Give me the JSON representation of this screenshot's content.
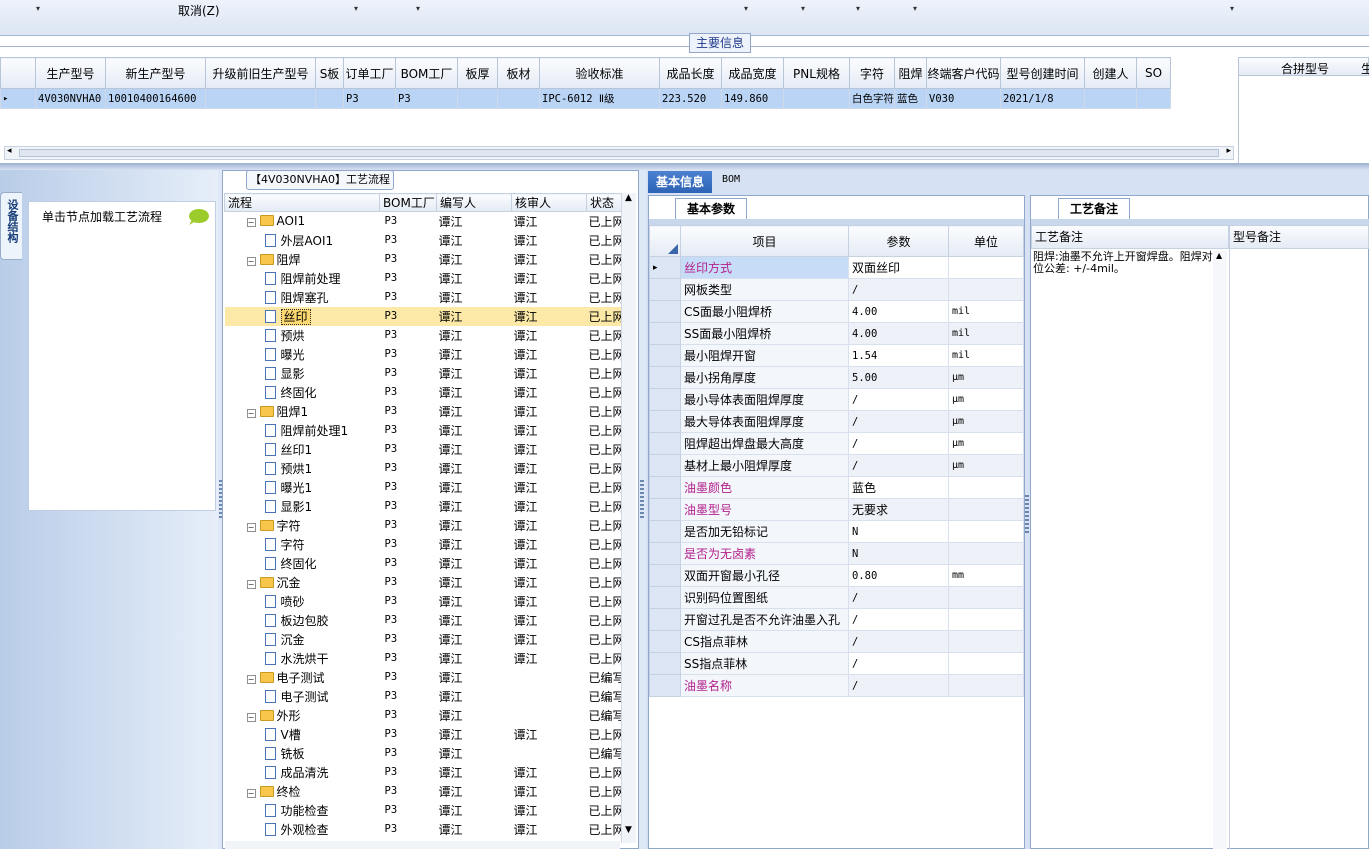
{
  "toolbar": {
    "cancel_label": "取消(Z)"
  },
  "main_info": {
    "tab_label": "主要信息",
    "columns": [
      "生产型号",
      "新生产型号",
      "升级前旧生产型号",
      "S板",
      "订单工厂",
      "BOM工厂",
      "板厚",
      "板材",
      "验收标准",
      "成品长度",
      "成品宽度",
      "PNL规格",
      "字符",
      "阻焊",
      "终端客户代码",
      "型号创建时间",
      "创建人",
      "SO"
    ],
    "row": [
      "4V030NVHA0",
      "10010400164600",
      "",
      "",
      "P3",
      "P3",
      "",
      "",
      "IPC-6012 Ⅱ级",
      "223.520",
      "149.860",
      "",
      "白色字符",
      "蓝色",
      "V030",
      "2021/1/8",
      "",
      ""
    ],
    "merge_column": "合拼型号",
    "extra_column": "生"
  },
  "left_nav": {
    "vertical_tab": "设备结构",
    "load_hint": "单击节点加载工艺流程"
  },
  "flow": {
    "title": "【4V030NVHA0】工艺流程",
    "columns": [
      "流程",
      "BOM工厂",
      "编写人",
      "核审人",
      "状态"
    ],
    "rows": [
      {
        "name": "AOI1",
        "level": 0,
        "folder": true,
        "bom": "P3",
        "writer": "谭江",
        "reviewer": "谭江",
        "status": "已上网"
      },
      {
        "name": "外层AOI1",
        "level": 1,
        "folder": false,
        "bom": "P3",
        "writer": "谭江",
        "reviewer": "谭江",
        "status": "已上网"
      },
      {
        "name": "阻焊",
        "level": 0,
        "folder": true,
        "bom": "P3",
        "writer": "谭江",
        "reviewer": "谭江",
        "status": "已上网"
      },
      {
        "name": "阻焊前处理",
        "level": 1,
        "folder": false,
        "bom": "P3",
        "writer": "谭江",
        "reviewer": "谭江",
        "status": "已上网"
      },
      {
        "name": "阻焊塞孔",
        "level": 1,
        "folder": false,
        "bom": "P3",
        "writer": "谭江",
        "reviewer": "谭江",
        "status": "已上网"
      },
      {
        "name": "丝印",
        "level": 1,
        "folder": false,
        "bom": "P3",
        "writer": "谭江",
        "reviewer": "谭江",
        "status": "已上网",
        "selected": true
      },
      {
        "name": "预烘",
        "level": 1,
        "folder": false,
        "bom": "P3",
        "writer": "谭江",
        "reviewer": "谭江",
        "status": "已上网"
      },
      {
        "name": "曝光",
        "level": 1,
        "folder": false,
        "bom": "P3",
        "writer": "谭江",
        "reviewer": "谭江",
        "status": "已上网"
      },
      {
        "name": "显影",
        "level": 1,
        "folder": false,
        "bom": "P3",
        "writer": "谭江",
        "reviewer": "谭江",
        "status": "已上网"
      },
      {
        "name": "终固化",
        "level": 1,
        "folder": false,
        "bom": "P3",
        "writer": "谭江",
        "reviewer": "谭江",
        "status": "已上网"
      },
      {
        "name": "阻焊1",
        "level": 0,
        "folder": true,
        "bom": "P3",
        "writer": "谭江",
        "reviewer": "谭江",
        "status": "已上网"
      },
      {
        "name": "阻焊前处理1",
        "level": 1,
        "folder": false,
        "bom": "P3",
        "writer": "谭江",
        "reviewer": "谭江",
        "status": "已上网"
      },
      {
        "name": "丝印1",
        "level": 1,
        "folder": false,
        "bom": "P3",
        "writer": "谭江",
        "reviewer": "谭江",
        "status": "已上网"
      },
      {
        "name": "预烘1",
        "level": 1,
        "folder": false,
        "bom": "P3",
        "writer": "谭江",
        "reviewer": "谭江",
        "status": "已上网"
      },
      {
        "name": "曝光1",
        "level": 1,
        "folder": false,
        "bom": "P3",
        "writer": "谭江",
        "reviewer": "谭江",
        "status": "已上网"
      },
      {
        "name": "显影1",
        "level": 1,
        "folder": false,
        "bom": "P3",
        "writer": "谭江",
        "reviewer": "谭江",
        "status": "已上网"
      },
      {
        "name": "字符",
        "level": 0,
        "folder": true,
        "bom": "P3",
        "writer": "谭江",
        "reviewer": "谭江",
        "status": "已上网"
      },
      {
        "name": "字符",
        "level": 1,
        "folder": false,
        "bom": "P3",
        "writer": "谭江",
        "reviewer": "谭江",
        "status": "已上网"
      },
      {
        "name": "终固化",
        "level": 1,
        "folder": false,
        "bom": "P3",
        "writer": "谭江",
        "reviewer": "谭江",
        "status": "已上网"
      },
      {
        "name": "沉金",
        "level": 0,
        "folder": true,
        "bom": "P3",
        "writer": "谭江",
        "reviewer": "谭江",
        "status": "已上网"
      },
      {
        "name": "喷砂",
        "level": 1,
        "folder": false,
        "bom": "P3",
        "writer": "谭江",
        "reviewer": "谭江",
        "status": "已上网"
      },
      {
        "name": "板边包胶",
        "level": 1,
        "folder": false,
        "bom": "P3",
        "writer": "谭江",
        "reviewer": "谭江",
        "status": "已上网"
      },
      {
        "name": "沉金",
        "level": 1,
        "folder": false,
        "bom": "P3",
        "writer": "谭江",
        "reviewer": "谭江",
        "status": "已上网"
      },
      {
        "name": "水洗烘干",
        "level": 1,
        "folder": false,
        "bom": "P3",
        "writer": "谭江",
        "reviewer": "谭江",
        "status": "已上网"
      },
      {
        "name": "电子测试",
        "level": 0,
        "folder": true,
        "bom": "P3",
        "writer": "谭江",
        "reviewer": "",
        "status": "已编写"
      },
      {
        "name": "电子测试",
        "level": 1,
        "folder": false,
        "bom": "P3",
        "writer": "谭江",
        "reviewer": "",
        "status": "已编写"
      },
      {
        "name": "外形",
        "level": 0,
        "folder": true,
        "bom": "P3",
        "writer": "谭江",
        "reviewer": "",
        "status": "已编写"
      },
      {
        "name": "V槽",
        "level": 1,
        "folder": false,
        "bom": "P3",
        "writer": "谭江",
        "reviewer": "谭江",
        "status": "已上网"
      },
      {
        "name": "铣板",
        "level": 1,
        "folder": false,
        "bom": "P3",
        "writer": "谭江",
        "reviewer": "",
        "status": "已编写"
      },
      {
        "name": "成品清洗",
        "level": 1,
        "folder": false,
        "bom": "P3",
        "writer": "谭江",
        "reviewer": "谭江",
        "status": "已上网"
      },
      {
        "name": "终检",
        "level": 0,
        "folder": true,
        "bom": "P3",
        "writer": "谭江",
        "reviewer": "谭江",
        "status": "已上网"
      },
      {
        "name": "功能检查",
        "level": 1,
        "folder": false,
        "bom": "P3",
        "writer": "谭江",
        "reviewer": "谭江",
        "status": "已上网"
      },
      {
        "name": "外观检查",
        "level": 1,
        "folder": false,
        "bom": "P3",
        "writer": "谭江",
        "reviewer": "谭江",
        "status": "已上网"
      }
    ]
  },
  "right_tabs": {
    "basic_info": "基本信息",
    "bom": "BOM"
  },
  "basic_params": {
    "tab_label": "基本参数",
    "columns": [
      "项目",
      "参数",
      "单位"
    ],
    "rows": [
      {
        "item": "丝印方式",
        "value": "双面丝印",
        "unit": "",
        "pink": true,
        "current": true
      },
      {
        "item": "网板类型",
        "value": "/",
        "unit": ""
      },
      {
        "item": "CS面最小阻焊桥",
        "value": "4.00",
        "unit": "mil"
      },
      {
        "item": "SS面最小阻焊桥",
        "value": "4.00",
        "unit": "mil"
      },
      {
        "item": "最小阻焊开窗",
        "value": "1.54",
        "unit": "mil"
      },
      {
        "item": "最小拐角厚度",
        "value": "5.00",
        "unit": "μm"
      },
      {
        "item": "最小导体表面阻焊厚度",
        "value": "/",
        "unit": "μm"
      },
      {
        "item": "最大导体表面阻焊厚度",
        "value": "/",
        "unit": "μm"
      },
      {
        "item": "阻焊超出焊盘最大高度",
        "value": "/",
        "unit": "μm"
      },
      {
        "item": "基材上最小阻焊厚度",
        "value": "/",
        "unit": "μm"
      },
      {
        "item": "油墨颜色",
        "value": "蓝色",
        "unit": "",
        "pink": true
      },
      {
        "item": "油墨型号",
        "value": "无要求",
        "unit": "",
        "pink": true
      },
      {
        "item": "是否加无铅标记",
        "value": "N",
        "unit": ""
      },
      {
        "item": "是否为无卤素",
        "value": "N",
        "unit": "",
        "pink": true
      },
      {
        "item": "双面开窗最小孔径",
        "value": "0.80",
        "unit": "mm"
      },
      {
        "item": "识别码位置图纸",
        "value": "/",
        "unit": ""
      },
      {
        "item": "开窗过孔是否不允许油墨入孔",
        "value": "/",
        "unit": ""
      },
      {
        "item": "CS指点菲林",
        "value": "/",
        "unit": ""
      },
      {
        "item": "SS指点菲林",
        "value": "/",
        "unit": ""
      },
      {
        "item": "油墨名称",
        "value": "/",
        "unit": "",
        "pink": true
      }
    ]
  },
  "process_notes": {
    "tab_label": "工艺备注",
    "col_process": "工艺备注",
    "col_model": "型号备注",
    "process_text": "阻焊:油墨不允许上开窗焊盘。阻焊对位公差: +/-4mil。"
  },
  "colors": {
    "accent": "#2e63b5",
    "pink": "#b3208c",
    "selection": "#b9d4f5",
    "tree_selection": "#fce9a8"
  }
}
